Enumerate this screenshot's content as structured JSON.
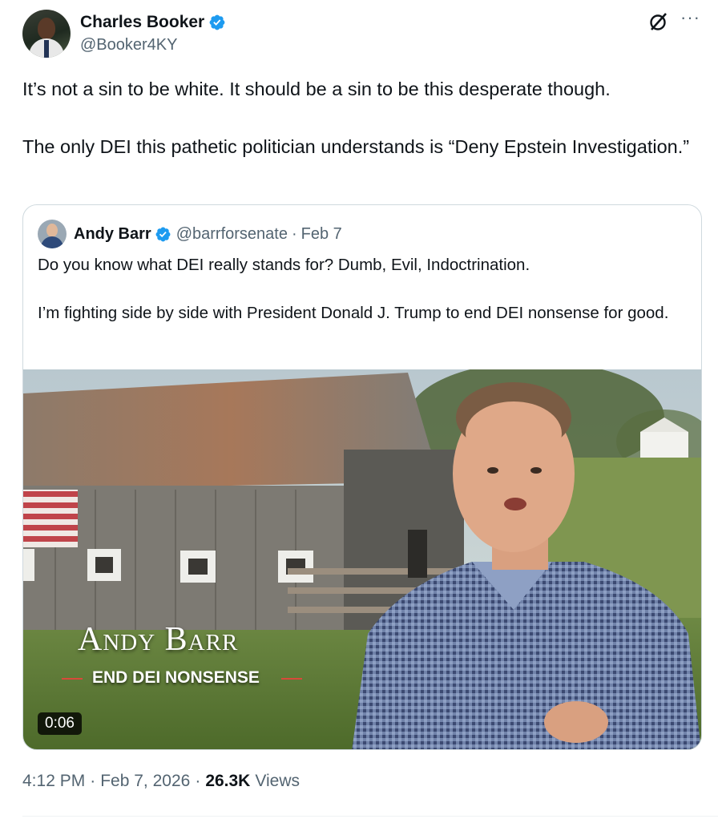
{
  "tweet": {
    "author_name": "Charles Booker",
    "author_handle": "@Booker4KY",
    "verified_icon": "verified-badge-icon",
    "paragraphs": [
      "It’s not a sin to be white. It should be a sin to be this desperate though.",
      "The only DEI this pathetic politician understands is “Deny Epstein Investigation.”"
    ],
    "time": "4:12 PM",
    "date": "Feb 7, 2026",
    "views_count": "26.3K",
    "views_label": "Views",
    "separator": "·"
  },
  "quote": {
    "author_name": "Andy Barr",
    "author_handle": "@barrforsenate",
    "date": "Feb 7",
    "separator": "·",
    "paragraphs": [
      "Do you know what DEI really stands for? Dumb, Evil, Indoctrination.",
      "I’m fighting side by side with President Donald J. Trump to end DEI nonsense for good."
    ],
    "video": {
      "overlay_title": "Andy Barr",
      "overlay_subtitle": "END DEI NONSENSE",
      "duration": "0:06"
    }
  },
  "icons": {
    "grok": "grok-icon",
    "more": "more-options-icon",
    "more_glyph": "···"
  },
  "colors": {
    "verified_blue": "#1d9bf0",
    "secondary_text": "#536471",
    "primary_text": "#0f1419",
    "border": "#cfd9de",
    "accent_red": "#d84a3a"
  }
}
